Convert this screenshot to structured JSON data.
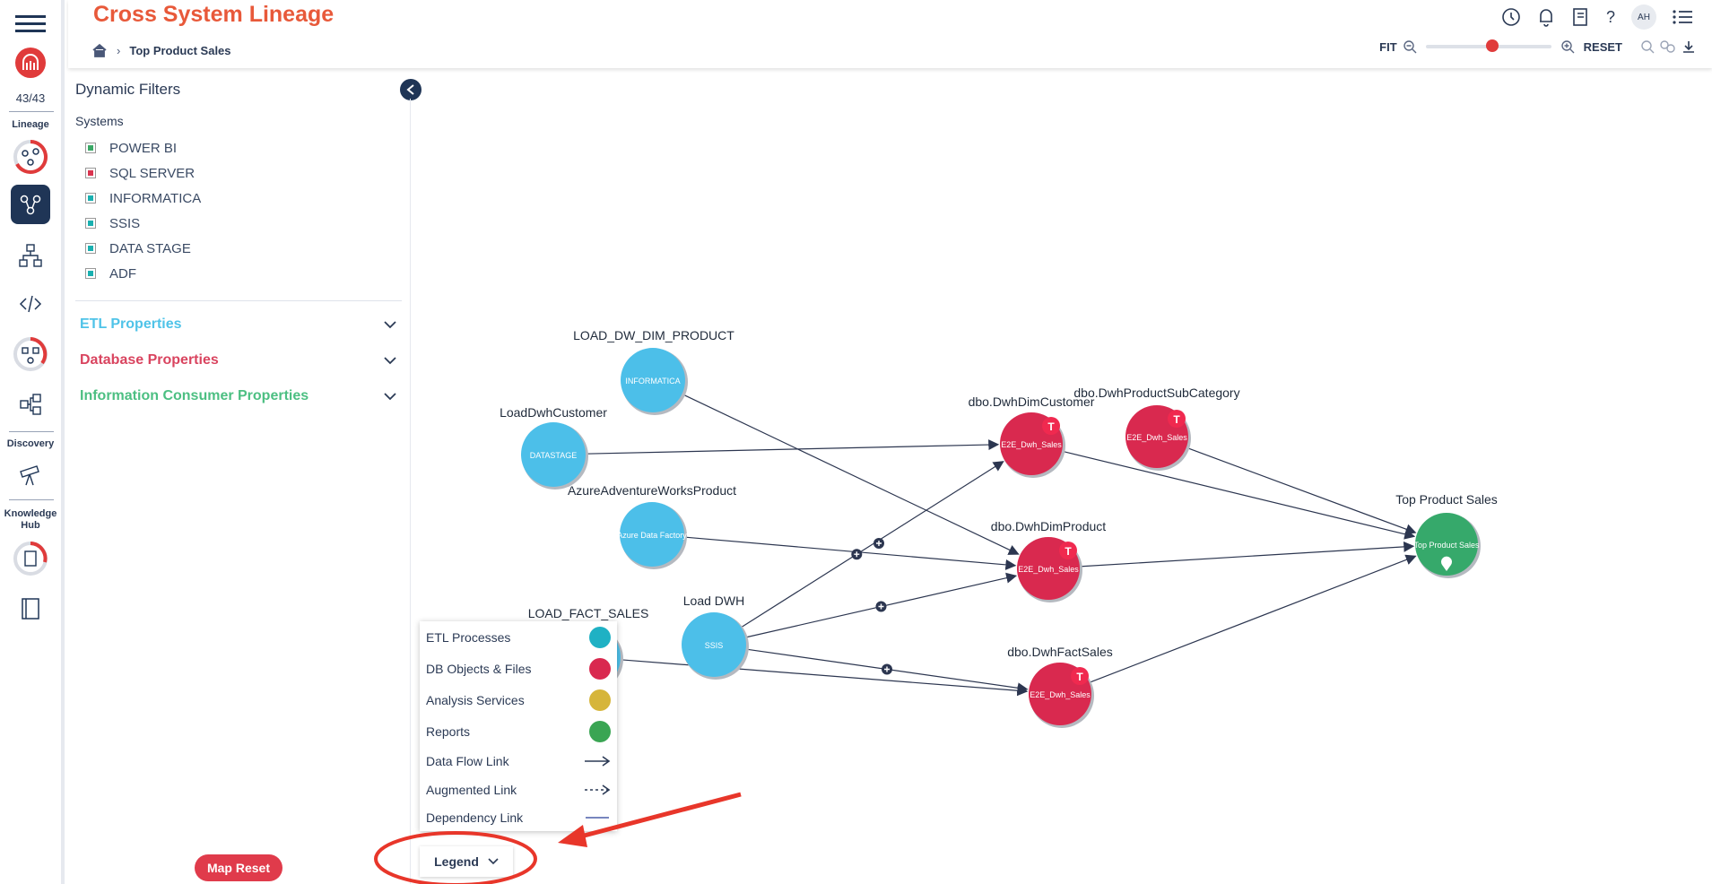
{
  "rail": {
    "counter": "43/43",
    "lineage_label": "Lineage",
    "discovery_label": "Discovery",
    "knowledge_label": "Knowledge Hub"
  },
  "header": {
    "title": "Cross System Lineage",
    "user_initials": "AH"
  },
  "breadcrumb": {
    "current": "Top Product Sales"
  },
  "zoom": {
    "fit_label": "FIT",
    "reset_label": "RESET",
    "level": 0.53
  },
  "filters": {
    "title": "Dynamic Filters",
    "systems_label": "Systems",
    "systems": [
      {
        "label": "POWER BI",
        "color": "#3aa866"
      },
      {
        "label": "SQL SERVER",
        "color": "#d9344f"
      },
      {
        "label": "INFORMATICA",
        "color": "#1ab0b0"
      },
      {
        "label": "SSIS",
        "color": "#1ab0b0"
      },
      {
        "label": "DATA STAGE",
        "color": "#1ab0b0"
      },
      {
        "label": "ADF",
        "color": "#1ab0b0"
      }
    ],
    "sections": [
      {
        "label": "ETL Properties",
        "color": "#4fc3e8"
      },
      {
        "label": "Database Properties",
        "color": "#d9445f"
      },
      {
        "label": "Information Consumer Properties",
        "color": "#4cbf82"
      }
    ]
  },
  "graph": {
    "nodes": [
      {
        "id": "load_dw_dim_product",
        "label": "LOAD_DW_DIM_PRODUCT",
        "inner": "INFORMATICA",
        "kind": "etl"
      },
      {
        "id": "load_dwh_customer",
        "label": "LoadDwhCustomer",
        "inner": "DATASTAGE",
        "kind": "etl"
      },
      {
        "id": "azure_aw_product",
        "label": "AzureAdventureWorksProduct",
        "inner": "Azure Data Factory",
        "kind": "etl"
      },
      {
        "id": "load_fact_sales",
        "label": "LOAD_FACT_SALES",
        "inner": "",
        "kind": "etl"
      },
      {
        "id": "load_dwh",
        "label": "Load DWH",
        "inner": "SSIS",
        "kind": "etl"
      },
      {
        "id": "dim_customer",
        "label": "dbo.DwhDimCustomer",
        "inner": "E2E_Dwh_Sales",
        "kind": "db",
        "badge": "T"
      },
      {
        "id": "prod_subcat",
        "label": "dbo.DwhProductSubCategory",
        "inner": "E2E_Dwh_Sales",
        "kind": "db",
        "badge": "T"
      },
      {
        "id": "dim_product",
        "label": "dbo.DwhDimProduct",
        "inner": "E2E_Dwh_Sales",
        "kind": "db",
        "badge": "T"
      },
      {
        "id": "fact_sales",
        "label": "dbo.DwhFactSales",
        "inner": "E2E_Dwh_Sales",
        "kind": "db",
        "badge": "T"
      },
      {
        "id": "top_product_sales",
        "label": "Top Product Sales",
        "inner": "Top Product Sales",
        "kind": "report"
      }
    ],
    "edges": [
      [
        "load_dw_dim_product",
        "dim_product"
      ],
      [
        "load_dwh_customer",
        "dim_customer"
      ],
      [
        "azure_aw_product",
        "dim_product"
      ],
      [
        "load_dwh",
        "dim_customer"
      ],
      [
        "load_dwh",
        "dim_product"
      ],
      [
        "load_dwh",
        "fact_sales"
      ],
      [
        "load_fact_sales",
        "fact_sales"
      ],
      [
        "dim_customer",
        "top_product_sales"
      ],
      [
        "prod_subcat",
        "top_product_sales"
      ],
      [
        "dim_product",
        "top_product_sales"
      ],
      [
        "fact_sales",
        "top_product_sales"
      ]
    ],
    "colors": {
      "etl": "#4cbfe9",
      "db": "#d9294f",
      "report": "#36a96b",
      "badge": "#f0294f",
      "edge": "#2c3650"
    }
  },
  "legend": {
    "items": [
      {
        "label": "ETL Processes",
        "type": "dot",
        "color": "#1fb1c4"
      },
      {
        "label": "DB Objects & Files",
        "type": "dot",
        "color": "#d9294f"
      },
      {
        "label": "Analysis Services",
        "type": "dot",
        "color": "#d6b53a"
      },
      {
        "label": "Reports",
        "type": "dot",
        "color": "#3aa553"
      },
      {
        "label": "Data Flow Link",
        "type": "solid-arrow"
      },
      {
        "label": "Augmented Link",
        "type": "dashed-arrow"
      },
      {
        "label": "Dependency Link",
        "type": "line"
      }
    ],
    "toggle_label": "Legend"
  },
  "map_reset_label": "Map Reset"
}
